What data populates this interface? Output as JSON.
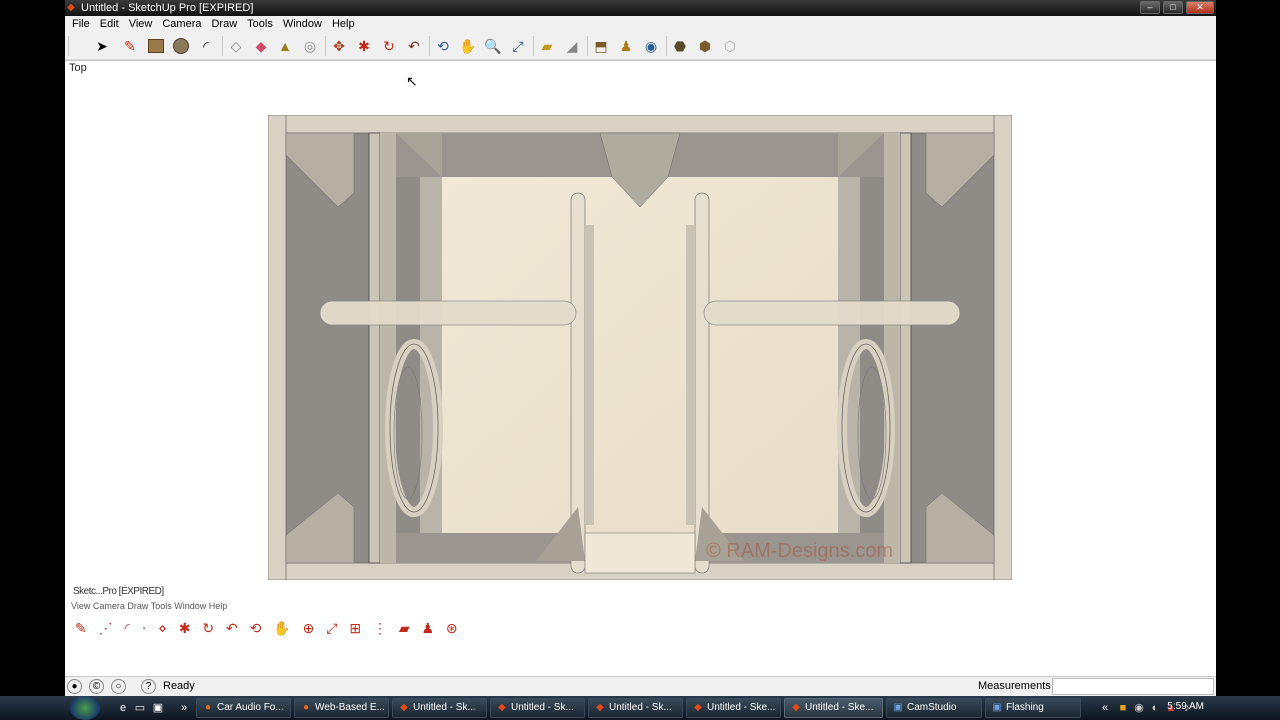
{
  "window": {
    "title": "Untitled - SketchUp Pro [EXPIRED]"
  },
  "menu": [
    "File",
    "Edit",
    "View",
    "Camera",
    "Draw",
    "Tools",
    "Window",
    "Help"
  ],
  "toolbar": {
    "icons": [
      "select-icon",
      "pencil-icon",
      "rectangle-icon",
      "circle-icon",
      "arc-icon",
      "eraser-icon",
      "paint-icon",
      "push-pull-icon",
      "follow-me-icon",
      "move-icon",
      "rotate-icon",
      "scale-icon",
      "offset-icon",
      "orbit-icon",
      "pan-icon",
      "zoom-icon",
      "zoom-extents-icon",
      "tape-icon",
      "protractor-icon",
      "section-icon",
      "dimension-icon",
      "text-icon",
      "axes-icon",
      "walk-icon",
      "look-around-icon",
      "position-camera-icon"
    ]
  },
  "viewport": {
    "view_label": "Top",
    "watermark": "© RAM-Designs.com"
  },
  "ghost": {
    "title": "Sketc...Pro [EXPIRED]",
    "menu": "View  Camera  Draw  Tools  Window  Help"
  },
  "status": {
    "text": "Ready",
    "measurements_label": "Measurements",
    "measurements_value": ""
  },
  "taskbar": {
    "items": [
      {
        "label": "Car Audio Fo...",
        "icon": "firefox-icon"
      },
      {
        "label": "Web-Based E...",
        "icon": "firefox-icon"
      },
      {
        "label": "Untitled - Sk...",
        "icon": "sketchup-icon"
      },
      {
        "label": "Untitled - Sk...",
        "icon": "sketchup-icon"
      },
      {
        "label": "Untitled - Sk...",
        "icon": "sketchup-icon"
      },
      {
        "label": "Untitled - Ske...",
        "icon": "sketchup-icon"
      },
      {
        "label": "Untitled - Ske...",
        "icon": "sketchup-icon"
      },
      {
        "label": "CamStudio",
        "icon": "camstudio-icon"
      },
      {
        "label": "Flashing",
        "icon": "flashing-icon"
      }
    ],
    "clock": "5:59 AM"
  },
  "colors": {
    "wood_light": "#eee5d4",
    "wood_dark": "#8c8985",
    "panel": "#d8d3c6",
    "titlebar": "#1a1a1a"
  }
}
